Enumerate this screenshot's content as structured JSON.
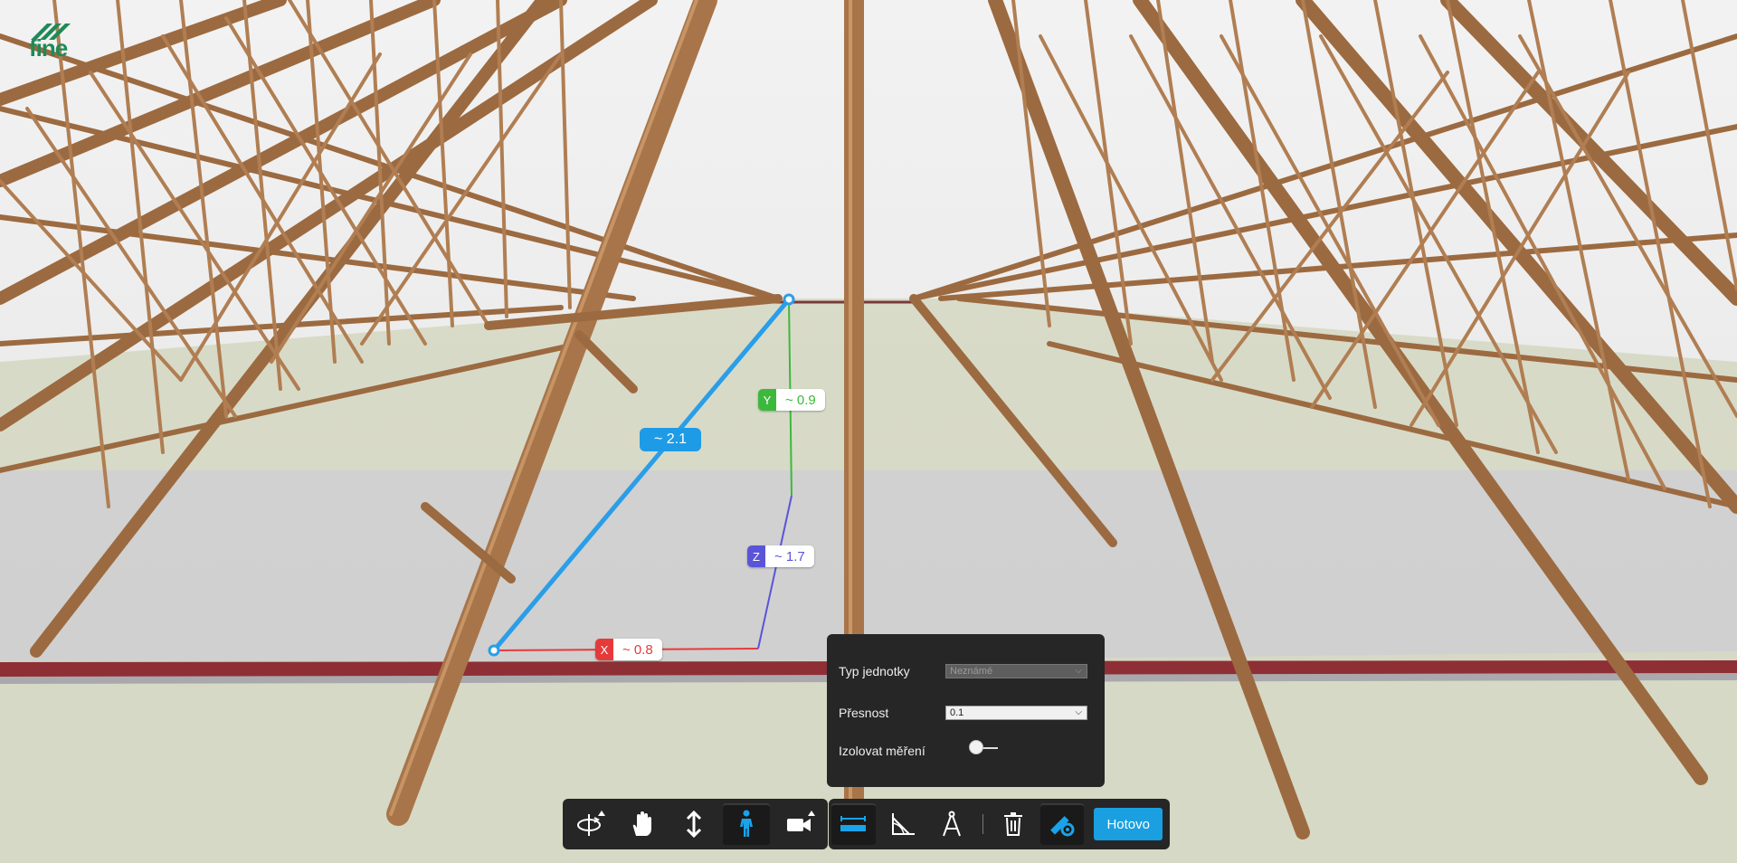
{
  "logo": {
    "text": "fine"
  },
  "measurement": {
    "total": "~ 2.1",
    "x": {
      "axis": "X",
      "value": "~ 0.8",
      "color": "#e63a3a"
    },
    "y": {
      "axis": "Y",
      "value": "~ 0.9",
      "color": "#3cb93c"
    },
    "z": {
      "axis": "Z",
      "value": "~ 1.7",
      "color": "#5a55d8"
    }
  },
  "settings": {
    "unit_label": "Typ jednotky",
    "unit_value": "Neznámé",
    "precision_label": "Přesnost",
    "precision_value": "0.1",
    "isolate_label": "Izolovat měření",
    "isolate_on": false
  },
  "nav_toolbar": {
    "tools": [
      "orbit-icon",
      "pan-hand-icon",
      "updown-arrow-icon",
      "walk-person-icon",
      "camera-icon"
    ]
  },
  "measure_toolbar": {
    "tools": [
      "distance-ruler-icon",
      "angle-icon",
      "area-compass-icon",
      "trash-icon",
      "measure-settings-icon"
    ],
    "done_label": "Hotovo"
  },
  "colors": {
    "accent": "#1a9fe0",
    "panel": "#262626",
    "wood": "#a8754a"
  }
}
